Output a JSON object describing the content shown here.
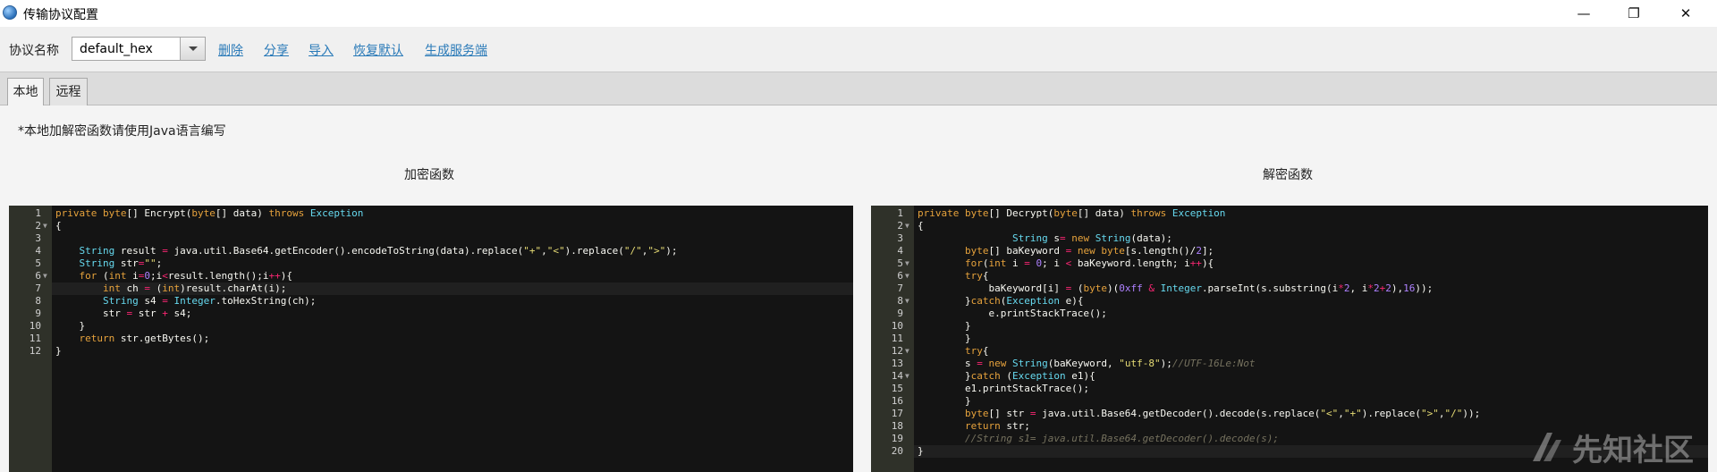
{
  "window": {
    "title": "传输协议配置",
    "minimize_glyph": "—",
    "maximize_glyph": "❐",
    "close_glyph": "✕"
  },
  "toolbar": {
    "protocol_label": "协议名称",
    "protocol_value": "default_hex",
    "links": [
      "删除",
      "分享",
      "导入",
      "恢复默认",
      "生成服务端"
    ]
  },
  "tabs": [
    {
      "label": "本地",
      "active": true
    },
    {
      "label": "远程",
      "active": false
    }
  ],
  "main": {
    "note": "*本地加解密函数请使用Java语言编写",
    "encrypt_caption": "加密函数",
    "decrypt_caption": "解密函数"
  },
  "encrypt_code": [
    "private byte[] Encrypt(byte[] data) throws Exception",
    "{",
    "",
    "    String result = java.util.Base64.getEncoder().encodeToString(data).replace(\"+\",\"<\").replace(\"/\",\">\");",
    "    String str=\"\";",
    "    for (int i=0;i<result.length();i++){",
    "        int ch = (int)result.charAt(i);",
    "        String s4 = Integer.toHexString(ch);",
    "        str = str + s4;",
    "    }",
    "    return str.getBytes();",
    "}"
  ],
  "decrypt_code": [
    "private byte[] Decrypt(byte[] data) throws Exception",
    "{",
    "                String s= new String(data);",
    "        byte[] baKeyword = new byte[s.length()/2];",
    "        for(int i = 0; i < baKeyword.length; i++){",
    "        try{",
    "            baKeyword[i] = (byte)(0xff & Integer.parseInt(s.substring(i*2, i*2+2),16));",
    "        }catch(Exception e){",
    "            e.printStackTrace();",
    "        }",
    "        }",
    "        try{",
    "        s = new String(baKeyword, \"utf-8\");//UTF-16Le:Not",
    "        }catch (Exception e1){",
    "        e1.printStackTrace();",
    "        }",
    "        byte[] str = java.util.Base64.getDecoder().decode(s.replace(\"<\",\"+\").replace(\">\",\"/\"));",
    "        return str;",
    "        //String s1= java.util.Base64.getDecoder().decode(s);",
    "}"
  ],
  "watermark": "先知社区",
  "colors": {
    "editor_bg": "#141414",
    "gutter_bg": "#2f3129",
    "keyword": "#e6a23c",
    "link": "#2a7ab8"
  }
}
